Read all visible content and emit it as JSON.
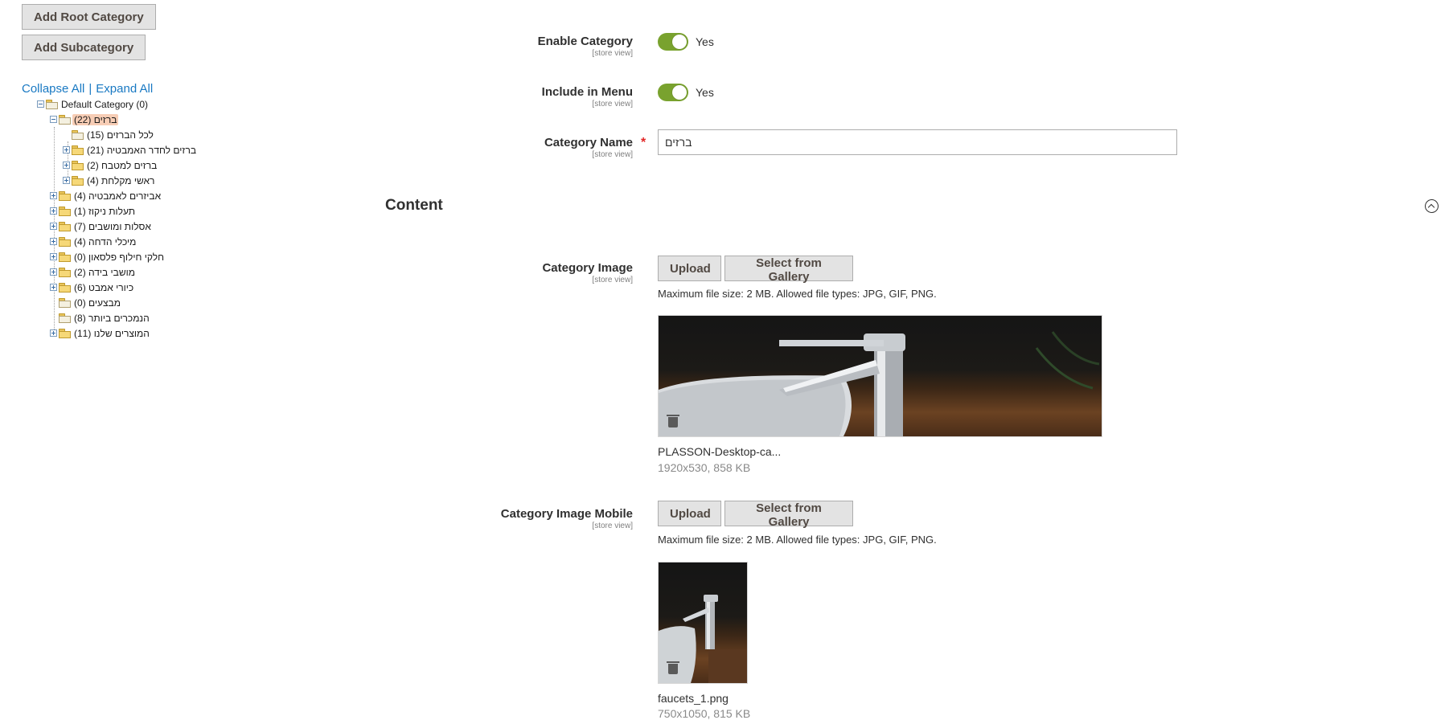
{
  "sidebar": {
    "add_root_label": "Add Root Category",
    "add_sub_label": "Add Subcategory",
    "collapse_all": "Collapse All",
    "separator": "|",
    "expand_all": "Expand All",
    "tree": [
      {
        "label": "Default Category (0)"
      },
      {
        "label": "ברזים (22)"
      },
      {
        "label": "לכל הברזים (15)"
      },
      {
        "label": "ברזים לחדר האמבטיה (21)"
      },
      {
        "label": "ברזים למטבח (2)"
      },
      {
        "label": "ראשי מקלחת (4)"
      },
      {
        "label": "אביזרים לאמבטיה (4)"
      },
      {
        "label": "תעלות ניקוז (1)"
      },
      {
        "label": "אסלות ומושבים (7)"
      },
      {
        "label": "מיכלי הדחה (4)"
      },
      {
        "label": "חלקי חילוף פלסאון (0)"
      },
      {
        "label": "מושבי בידה (2)"
      },
      {
        "label": "כיורי אמבט (6)"
      },
      {
        "label": "מבצעים (0)"
      },
      {
        "label": "הנמכרים ביותר (8)"
      },
      {
        "label": "המוצרים שלנו (11)"
      }
    ]
  },
  "form": {
    "scope_text": "[store view]",
    "enable_category": {
      "label": "Enable Category",
      "value": "Yes"
    },
    "include_in_menu": {
      "label": "Include in Menu",
      "value": "Yes"
    },
    "category_name": {
      "label": "Category Name",
      "required_mark": "*",
      "value": "ברזים"
    },
    "content_title": "Content",
    "category_image": {
      "label": "Category Image",
      "upload_label": "Upload",
      "gallery_label": "Select from Gallery",
      "note": "Maximum file size: 2 MB. Allowed file types: JPG, GIF, PNG.",
      "file_name": "PLASSON-Desktop-ca...",
      "file_meta": "1920x530, 858 KB"
    },
    "category_image_mobile": {
      "label": "Category Image Mobile",
      "upload_label": "Upload",
      "gallery_label": "Select from Gallery",
      "note": "Maximum file size: 2 MB. Allowed file types: JPG, GIF, PNG.",
      "file_name": "faucets_1.png",
      "file_meta": "750x1050, 815 KB"
    }
  },
  "colors": {
    "link": "#1979c3",
    "toggle_on": "#79a22e",
    "required": "#e22626",
    "selected_node": "#f7cdb5"
  }
}
